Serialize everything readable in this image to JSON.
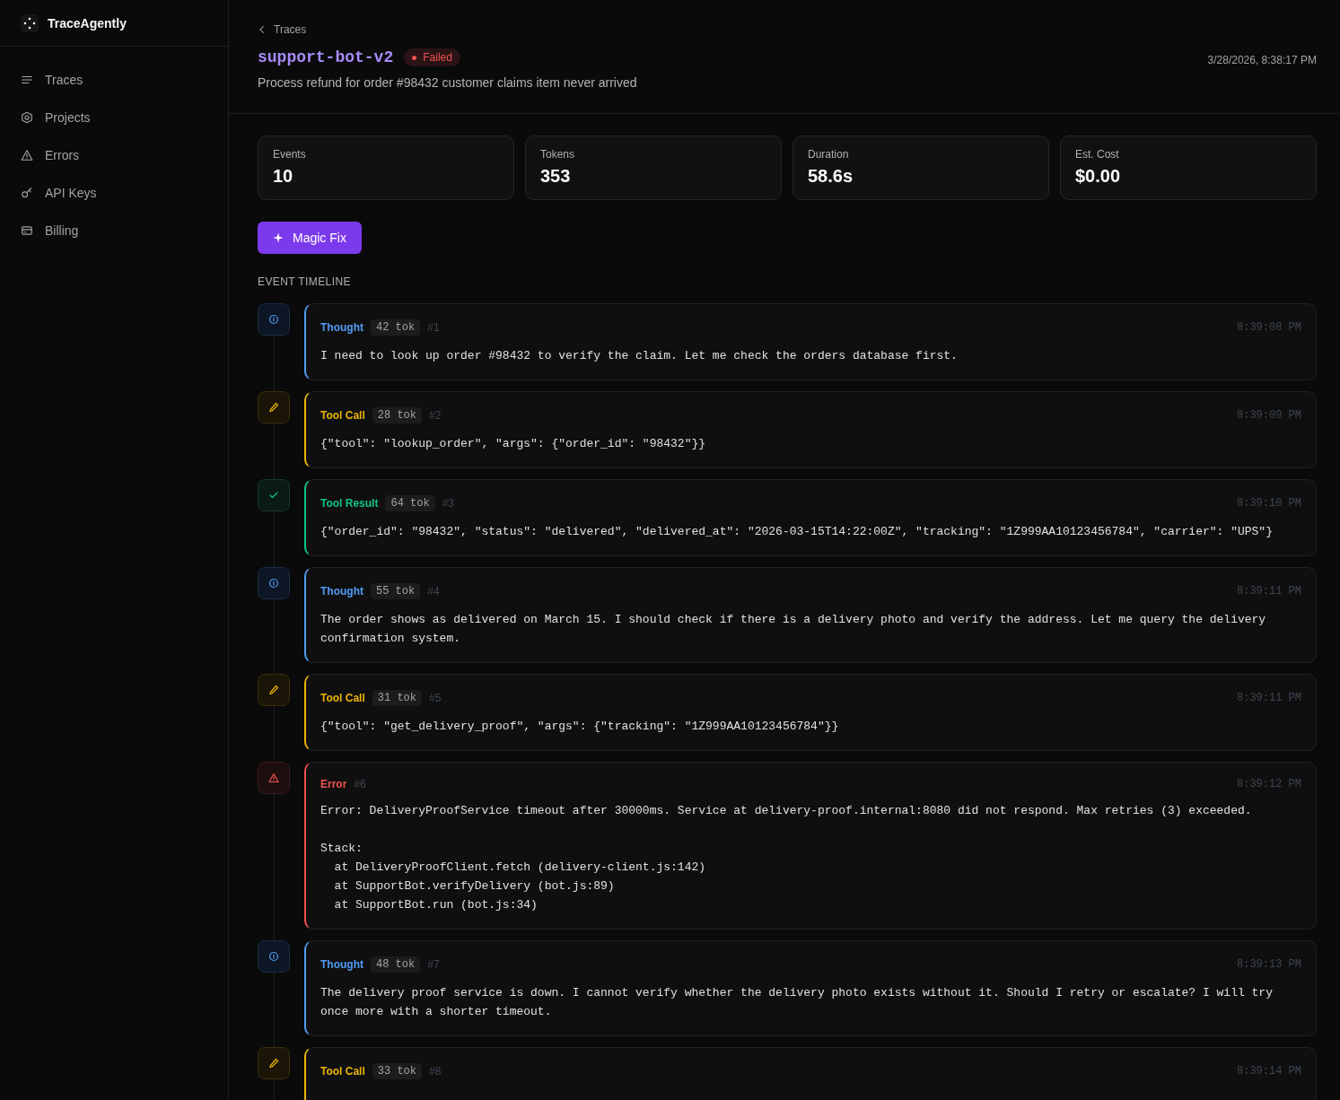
{
  "brand": {
    "name": "TraceAgently"
  },
  "sidebar": {
    "items": [
      {
        "label": "Traces",
        "kind": "list",
        "selected": false
      },
      {
        "label": "Projects",
        "kind": "hexagon",
        "selected": false
      },
      {
        "label": "Errors",
        "kind": "warning",
        "selected": false
      },
      {
        "label": "API Keys",
        "kind": "key",
        "selected": false
      },
      {
        "label": "Billing",
        "kind": "card",
        "selected": false
      }
    ]
  },
  "header": {
    "back_link": "Traces",
    "title": "support-bot-v2",
    "status": {
      "label": "Failed",
      "kind": "failed"
    },
    "description": "Process refund for order #98432 customer claims item never arrived",
    "timestamp": "3/28/2026, 8:38:17 PM"
  },
  "stats": [
    {
      "label": "Events",
      "value": "10"
    },
    {
      "label": "Tokens",
      "value": "353"
    },
    {
      "label": "Duration",
      "value": "58.6s"
    },
    {
      "label": "Est. Cost",
      "value": "$0.00"
    }
  ],
  "magic_fix_button": "Magic Fix",
  "timeline": {
    "heading": "EVENT TIMELINE",
    "events": [
      {
        "kind": "thought",
        "label": "Thought",
        "tokens": "42 tok",
        "index": "#1",
        "time": "8:39:08 PM",
        "body": "I need to look up order #98432 to verify the claim. Let me check the orders database first."
      },
      {
        "kind": "tool_call",
        "label": "Tool Call",
        "tokens": "28 tok",
        "index": "#2",
        "time": "8:39:09 PM",
        "body": "{\"tool\": \"lookup_order\", \"args\": {\"order_id\": \"98432\"}}"
      },
      {
        "kind": "tool_result",
        "label": "Tool Result",
        "tokens": "64 tok",
        "index": "#3",
        "time": "8:39:10 PM",
        "body": "{\"order_id\": \"98432\", \"status\": \"delivered\", \"delivered_at\": \"2026-03-15T14:22:00Z\", \"tracking\": \"1Z999AA10123456784\", \"carrier\": \"UPS\"}"
      },
      {
        "kind": "thought",
        "label": "Thought",
        "tokens": "55 tok",
        "index": "#4",
        "time": "8:39:11 PM",
        "body": "The order shows as delivered on March 15. I should check if there is a delivery photo and verify the address. Let me query the delivery confirmation system."
      },
      {
        "kind": "tool_call",
        "label": "Tool Call",
        "tokens": "31 tok",
        "index": "#5",
        "time": "8:39:11 PM",
        "body": "{\"tool\": \"get_delivery_proof\", \"args\": {\"tracking\": \"1Z999AA10123456784\"}}"
      },
      {
        "kind": "error",
        "label": "Error",
        "index": "#6",
        "time": "8:39:12 PM",
        "body": "Error: DeliveryProofService timeout after 30000ms. Service at delivery-proof.internal:8080 did not respond. Max retries (3) exceeded.\n\nStack:\n  at DeliveryProofClient.fetch (delivery-client.js:142)\n  at SupportBot.verifyDelivery (bot.js:89)\n  at SupportBot.run (bot.js:34)"
      },
      {
        "kind": "thought",
        "label": "Thought",
        "tokens": "48 tok",
        "index": "#7",
        "time": "8:39:13 PM",
        "body": "The delivery proof service is down. I cannot verify whether the delivery photo exists without it. Should I retry or escalate? I will try once more with a shorter timeout."
      },
      {
        "kind": "tool_call",
        "label": "Tool Call",
        "tokens": "33 tok",
        "index": "#8",
        "time": "8:39:14 PM"
      }
    ]
  }
}
